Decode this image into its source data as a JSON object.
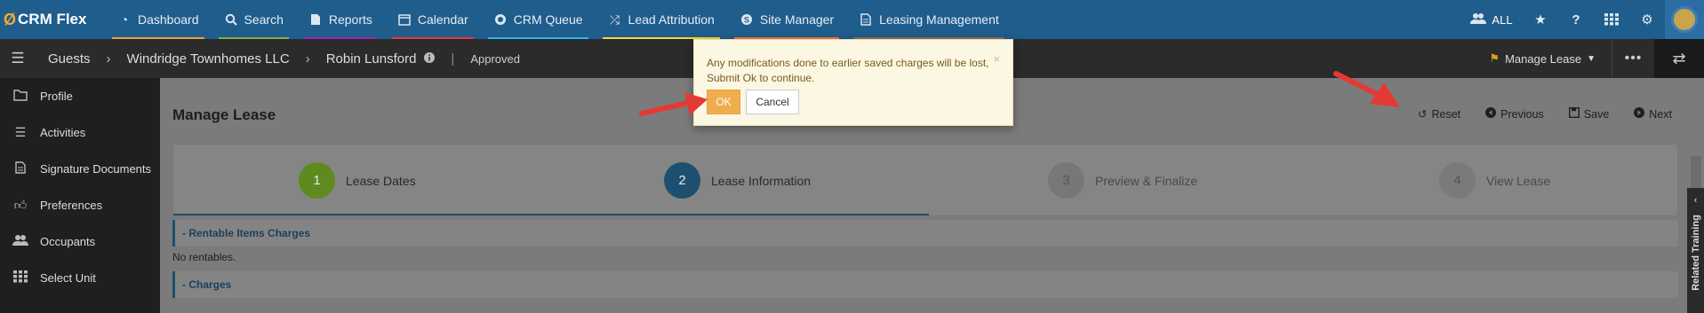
{
  "app": {
    "logo_text": "CRM Flex"
  },
  "topnav": {
    "items": [
      {
        "label": "Dashboard",
        "icon": "dashboard-icon"
      },
      {
        "label": "Search",
        "icon": "search-icon"
      },
      {
        "label": "Reports",
        "icon": "reports-icon"
      },
      {
        "label": "Calendar",
        "icon": "calendar-icon"
      },
      {
        "label": "CRM Queue",
        "icon": "crm-queue-icon"
      },
      {
        "label": "Lead Attribution",
        "icon": "shuffle-icon"
      },
      {
        "label": "Site Manager",
        "icon": "site-manager-icon"
      },
      {
        "label": "Leasing Management",
        "icon": "document-icon"
      }
    ],
    "all_label": "ALL",
    "right_icons": [
      "users-icon",
      "star-icon",
      "help-icon",
      "grid-icon",
      "gear-icon",
      "avatar-icon"
    ]
  },
  "subbar": {
    "breadcrumb": [
      "Guests",
      "Windridge Townhomes LLC",
      "Robin Lunsford"
    ],
    "status": "Approved",
    "manage_lease_label": "Manage Lease"
  },
  "sidebar": {
    "items": [
      {
        "label": "Profile",
        "icon": "folder-icon"
      },
      {
        "label": "Activities",
        "icon": "list-icon"
      },
      {
        "label": "Signature Documents",
        "icon": "document-icon"
      },
      {
        "label": "Preferences",
        "icon": "thumbs-up-icon"
      },
      {
        "label": "Occupants",
        "icon": "users-icon"
      },
      {
        "label": "Select Unit",
        "icon": "grid-icon"
      }
    ]
  },
  "main": {
    "title": "Manage Lease",
    "actions": [
      {
        "label": "Reset",
        "icon": "reset-icon"
      },
      {
        "label": "Previous",
        "icon": "previous-icon"
      },
      {
        "label": "Save",
        "icon": "save-icon"
      },
      {
        "label": "Next",
        "icon": "next-icon"
      }
    ],
    "steps": [
      {
        "number": "1",
        "label": "Lease Dates",
        "color": "#5f8a1f"
      },
      {
        "number": "2",
        "label": "Lease Information",
        "color": "#1d4f70"
      },
      {
        "number": "3",
        "label": "Preview & Finalize",
        "color": "#777777"
      },
      {
        "number": "4",
        "label": "View Lease",
        "color": "#7a7a7a"
      }
    ],
    "sections": {
      "rentable_title": "- Rentable Items Charges",
      "rentable_empty": "No rentables.",
      "charges_title": "- Charges"
    }
  },
  "related_training": {
    "label": "Related Training"
  },
  "dialog": {
    "message": "Any modifications done to earlier saved charges will be lost, Submit Ok to continue.",
    "ok_label": "OK",
    "cancel_label": "Cancel",
    "close_symbol": "×"
  },
  "colors": {
    "topnav": "#1f5d8c",
    "ok_button": "#f0ad4e",
    "annotation_arrow": "#e53935"
  }
}
